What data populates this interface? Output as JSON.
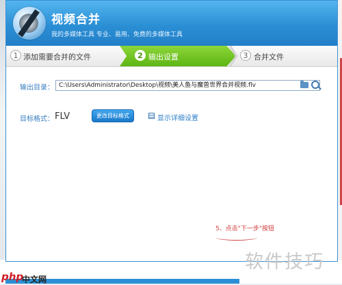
{
  "app": {
    "title": "视频合并",
    "subtitle": "视频合并"
  },
  "header": {
    "title": "视频合并",
    "subtitle": "我的多媒体工具 专业、易用、免费的多媒体工具"
  },
  "steps": [
    {
      "num": "1",
      "label": "添加需要合并的文件",
      "active": false
    },
    {
      "num": "2",
      "label": "输出设置",
      "active": true
    },
    {
      "num": "3",
      "label": "合并文件",
      "active": false
    }
  ],
  "output": {
    "label": "输出目录：",
    "path": "C:\\Users\\Administrator\\Desktop\\视频\\美人鱼与魔兽世界合并视频.flv"
  },
  "format": {
    "label": "目标格式：",
    "value": "FLV",
    "change_button": "更改目标格式",
    "detail_link": "显示详细设置"
  },
  "annotation": "5、点击\"下一步\"按钮",
  "watermark": "软件技巧",
  "site_logo": {
    "brand": "php",
    "text": "中文网"
  },
  "colors": {
    "header": "#2b8fd5",
    "active_step": "#6cc22a",
    "annotation": "#d23a3a"
  }
}
